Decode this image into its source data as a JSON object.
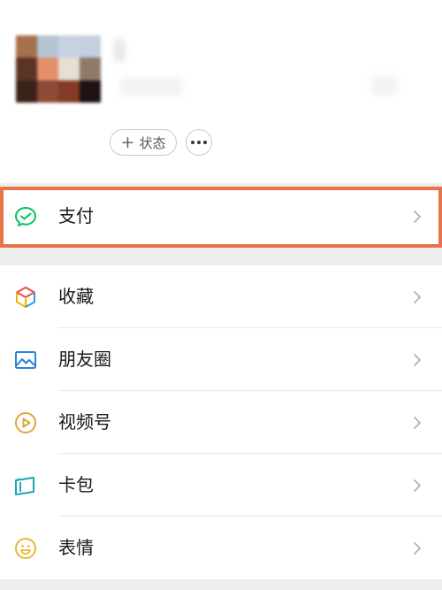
{
  "profile": {
    "avatar_colors": [
      "#a5704a",
      "#b6c3d4",
      "#c6d2e2",
      "#c4cfdf",
      "#5b3425",
      "#e48f6c",
      "#e6dfd4",
      "#8f7a6a",
      "#3a2218",
      "#8d4a37",
      "#843a26",
      "#1f1212"
    ],
    "status_button": {
      "plus": "+",
      "label": "状态"
    },
    "more_button_icon": "more-dots-icon"
  },
  "menu": {
    "pay": {
      "label": "支付",
      "icon": "wechat-pay-icon"
    },
    "items": [
      {
        "label": "收藏",
        "icon": "favorites-cube-icon"
      },
      {
        "label": "朋友圈",
        "icon": "moments-picture-icon"
      },
      {
        "label": "视频号",
        "icon": "channels-play-icon"
      },
      {
        "label": "卡包",
        "icon": "card-wallet-icon"
      },
      {
        "label": "表情",
        "icon": "sticker-smile-icon"
      }
    ]
  },
  "colors": {
    "highlight": "#e8734a",
    "wechat_green": "#07c160",
    "chevron": "#b2b2b2"
  }
}
